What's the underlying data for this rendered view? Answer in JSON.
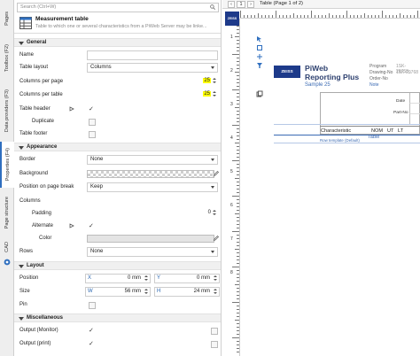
{
  "left_tabs": [
    {
      "label": "Pages"
    },
    {
      "label": "Toolbox (F2)"
    },
    {
      "label": "Data providers (F3)"
    },
    {
      "label": "Properties (F4)"
    },
    {
      "label": "Page structure"
    },
    {
      "label": "CAD"
    }
  ],
  "panel": {
    "search_placeholder": "Search (Ctrl+W)",
    "element_title": "Measurement table",
    "element_desc": "Table to which one or several characteristics from a PiWeb Server may be linke...",
    "sections": {
      "general": "General",
      "appearance": "Appearance",
      "layout": "Layout",
      "misc": "Miscellaneous"
    },
    "general": {
      "name_label": "Name",
      "name_value": "",
      "layout_label": "Table layout",
      "layout_value": "Columns",
      "cpp_label": "Columns per page",
      "cpp_value": "25",
      "cpt_label": "Columns per table",
      "cpt_value": "25",
      "header_label": "Table header",
      "duplicate_label": "Duplicate",
      "footer_label": "Table footer"
    },
    "appearance": {
      "border_label": "Border",
      "border_value": "None",
      "background_label": "Background",
      "position_label": "Position on page break",
      "position_value": "Keep",
      "columns_label": "Columns",
      "padding_label": "Padding",
      "padding_value": "0",
      "alternate_label": "Alternate",
      "color_label": "Color",
      "rows_label": "Rows",
      "rows_value": "None"
    },
    "layout": {
      "position_label": "Position",
      "x_label": "X",
      "x_value": "0 mm",
      "y_label": "Y",
      "y_value": "0 mm",
      "size_label": "Size",
      "w_label": "W",
      "w_value": "56 mm",
      "h_label": "H",
      "h_value": "24 mm",
      "pin_label": "Pin"
    },
    "misc": {
      "out_monitor_label": "Output (Monitor)",
      "out_print_label": "Output (print)"
    }
  },
  "designer": {
    "page_nav_value": "1",
    "title": "Table (Page 1 of 2)",
    "ruler_numbers": [
      "1",
      "2",
      "3",
      "4",
      "5",
      "6",
      "7",
      "8"
    ],
    "zeiss_text": "ZEISS",
    "report": {
      "logo_text": "ZEISS",
      "title_line1": "PiWeb",
      "title_line2": "Reporting Plus",
      "subtitle": "Sample 25",
      "program_label": "Program",
      "program_value": "1SK-29758_",
      "drawing_label": "Drawing-No",
      "drawing_value": "1SK-29768",
      "order_label": "Order-No",
      "note_label": "Note",
      "date_label": "Date",
      "partno_label": "Part-No",
      "col_characteristic": "Characteristic",
      "col_nom": "NOM",
      "col_ut": "UT",
      "col_lt": "LT",
      "table_label": "Table",
      "row_template": "Row template (Default)",
      "highlight_note": "Fixed"
    }
  },
  "colors": {
    "highlight": "#ffff00",
    "accent": "#2f6fbf",
    "brand": "#1d3a8a"
  }
}
